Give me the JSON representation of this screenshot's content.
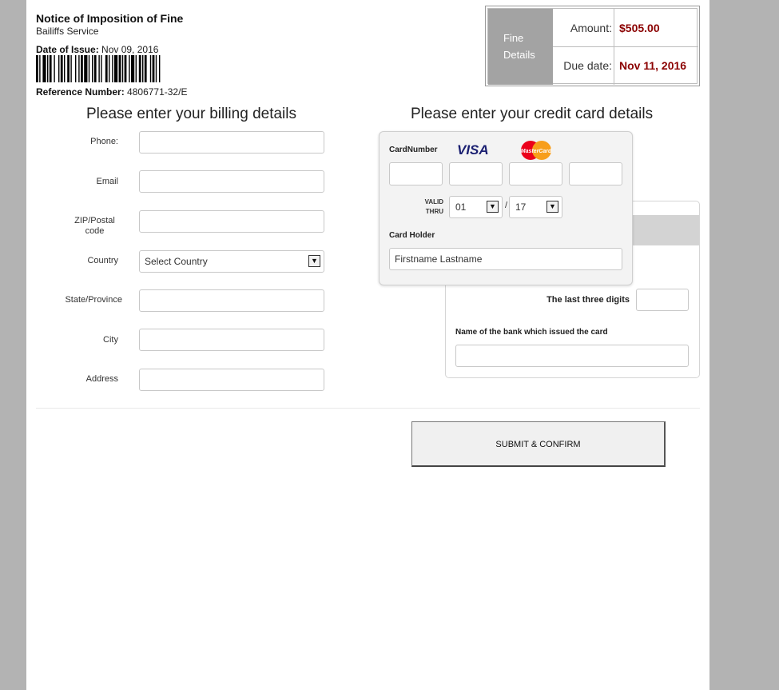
{
  "header": {
    "title": "Notice of Imposition of Fine",
    "subtitle": "Bailiffs Service",
    "date_of_issue_label": "Date of Issue:",
    "date_of_issue_value": "Nov 09, 2016",
    "reference_label": "Reference Number:",
    "reference_value": "4806771-32/E"
  },
  "fine_details": {
    "label_line1": "Fine",
    "label_line2": "Details",
    "amount_label": "Amount:",
    "amount_value": "$505.00",
    "due_label": "Due date:",
    "due_value": "Nov 11, 2016",
    "value_color": "#8b0000"
  },
  "billing": {
    "heading": "Please enter your billing details",
    "phone_label": "Phone:",
    "email_label": "Email",
    "zip_label_line1": "ZIP/Postal",
    "zip_label_line2": "code",
    "country_label": "Country",
    "country_value": "Select Country",
    "state_label": "State/Province",
    "city_label": "City",
    "address_label": "Address"
  },
  "card": {
    "heading": "Please enter your credit card details",
    "cardnumber_label": "CardNumber",
    "visa_text": "VISA",
    "mastercard_text": "MasterCard",
    "valid_line1": "VALID",
    "valid_line2": "THRU",
    "month_value": "01",
    "year_value": "17",
    "slash": "/",
    "holder_label": "Card Holder",
    "holder_placeholder": "Firstname Lastname",
    "last_three_label": "The last three digits",
    "bank_label": "Name of the bank which issued the card"
  },
  "submit": {
    "label": "SUBMIT & CONFIRM"
  },
  "icons": {
    "select_arrow": "chevron-down-icon",
    "barcode": "barcode-icon"
  }
}
